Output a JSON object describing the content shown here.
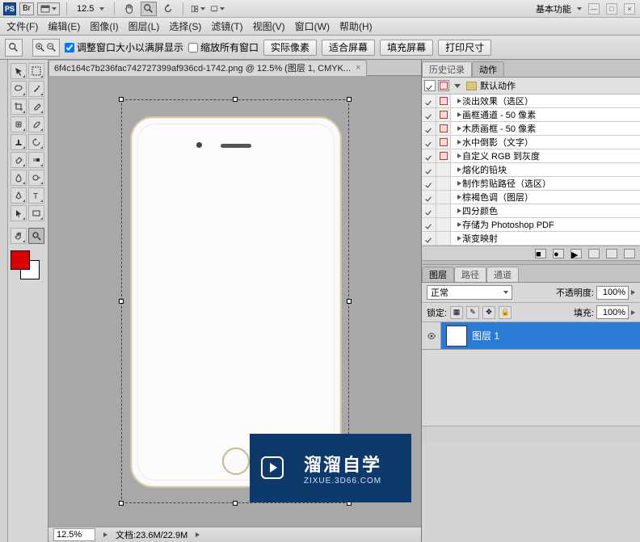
{
  "app_bar": {
    "ps": "PS",
    "br": "Br",
    "zoom_value": "12.5",
    "workspace_label": "基本功能"
  },
  "menu": {
    "file": "文件(F)",
    "edit": "编辑(E)",
    "image": "图像(I)",
    "layer": "图层(L)",
    "select": "选择(S)",
    "filter": "滤镜(T)",
    "view": "视图(V)",
    "window": "窗口(W)",
    "help": "帮助(H)"
  },
  "options": {
    "resize_window_label": "调整窗口大小以满屏显示",
    "zoom_all_label": "缩放所有窗口",
    "btn_actual": "实际像素",
    "btn_fit": "适合屏幕",
    "btn_fill": "填充屏幕",
    "btn_print": "打印尺寸"
  },
  "doc_tab": {
    "title": "6f4c164c7b236fac742727399af936cd-1742.png @ 12.5% (图层 1, CMYK...",
    "close": "×"
  },
  "status": {
    "zoom": "12.5%",
    "doc_info": "文档:23.6M/22.9M"
  },
  "history_actions_panel": {
    "tab_history": "历史记录",
    "tab_actions": "动作",
    "folder_label": "默认动作",
    "actions": [
      "淡出效果（选区）",
      "画框通道 - 50 像素",
      "木质画框 - 50 像素",
      "水中倒影（文字）",
      "自定义 RGB 到灰度",
      "熔化的铅块",
      "制作剪贴路径（选区）",
      "棕褐色调（图层）",
      "四分颜色",
      "存储为 Photoshop PDF",
      "渐变映射"
    ],
    "stop_flags": [
      true,
      true,
      true,
      true,
      true,
      false,
      false,
      false,
      false,
      false,
      false
    ]
  },
  "layers_panel": {
    "tab_layers": "图层",
    "tab_paths": "路径",
    "tab_channels": "通道",
    "blend_mode": "正常",
    "opacity_label": "不透明度:",
    "opacity_value": "100%",
    "lock_label": "锁定:",
    "fill_label": "填充:",
    "fill_value": "100%",
    "layer_name": "图层 1"
  },
  "watermark": {
    "big": "溜溜自学",
    "small": "ZIXUE.3D66.COM"
  }
}
